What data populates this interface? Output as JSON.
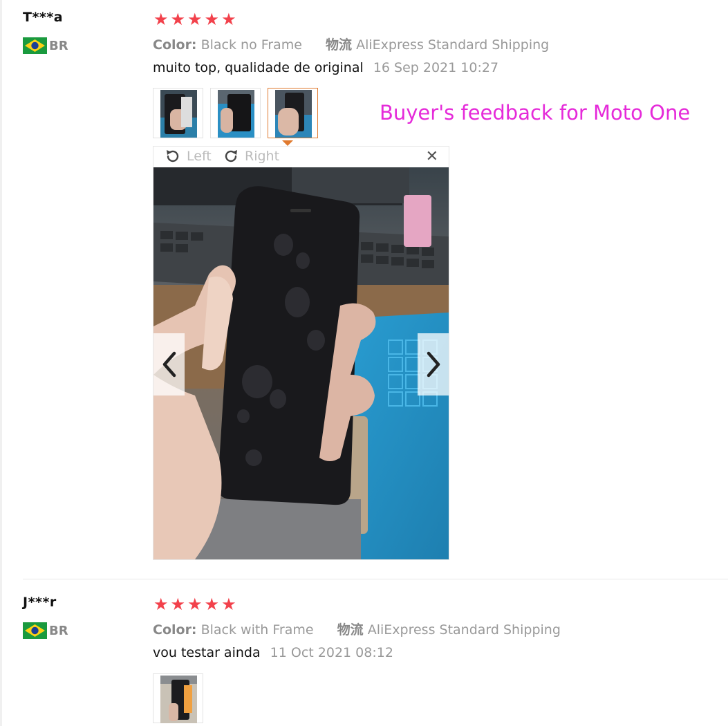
{
  "overlay_caption": "Buyer's feedback for Moto One",
  "colors": {
    "star": "#f2414b",
    "active_thumb": "#e07a2f",
    "caption": "#e52ad9"
  },
  "reviews": [
    {
      "user": "T***a",
      "country": "BR",
      "rating": 5,
      "color_label": "Color:",
      "color_value": "Black no Frame",
      "shipping_label": "物流",
      "shipping_value": "AliExpress Standard Shipping",
      "comment": "muito top, qualidade de original",
      "date": "16 Sep 2021 10:27",
      "thumbnails": [
        "photo-1",
        "photo-2",
        "photo-3"
      ],
      "active_thumbnail": 3,
      "viewer": {
        "rotate_left": "Left",
        "rotate_right": "Right",
        "close_icon": "close-icon",
        "prev_icon": "chevron-left-icon",
        "next_icon": "chevron-right-icon"
      }
    },
    {
      "user": "J***r",
      "country": "BR",
      "rating": 5,
      "color_label": "Color:",
      "color_value": "Black with Frame",
      "shipping_label": "物流",
      "shipping_value": "AliExpress Standard Shipping",
      "comment": "vou testar ainda",
      "date": "11 Oct 2021 08:12",
      "thumbnails": [
        "photo-1"
      ]
    }
  ]
}
